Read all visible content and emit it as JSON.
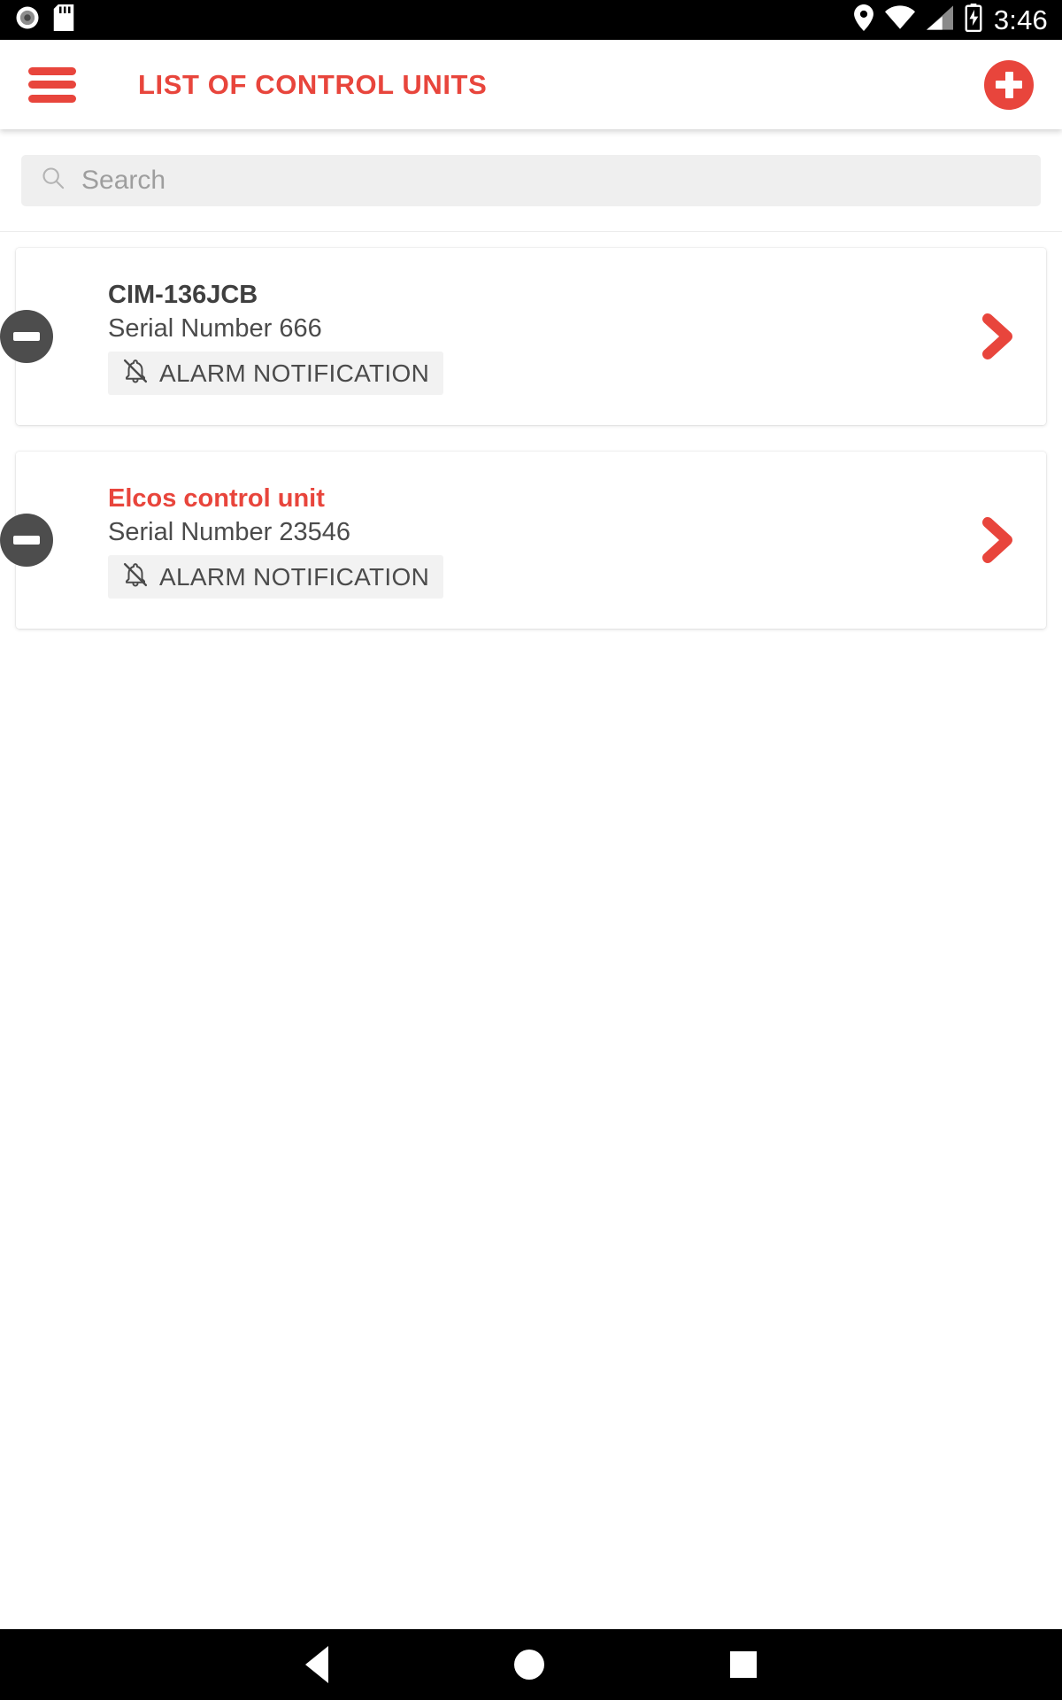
{
  "status_bar": {
    "icons_left": [
      "screen-record-icon",
      "sd-card-icon"
    ],
    "icons_right": [
      "location-pin-icon",
      "wifi-icon",
      "cellular-signal-icon",
      "battery-charging-icon"
    ],
    "time": "3:46"
  },
  "app_bar": {
    "menu_icon": "hamburger-menu-icon",
    "title": "LIST OF CONTROL UNITS",
    "add_icon": "plus-icon",
    "accent_color": "#e8453c"
  },
  "search": {
    "icon": "search-icon",
    "placeholder": "Search",
    "value": ""
  },
  "units": [
    {
      "name": "CIM-136JCB",
      "name_color": "#3f3f3f",
      "serial": "Serial Number 666",
      "status_icon": "minus-circle-icon",
      "alarm_icon": "bell-off-icon",
      "alarm_label": "ALARM NOTIFICATION",
      "chevron_icon": "chevron-right-icon"
    },
    {
      "name": "Elcos control unit",
      "name_color": "#e8453c",
      "serial": "Serial Number 23546",
      "status_icon": "minus-circle-icon",
      "alarm_icon": "bell-off-icon",
      "alarm_label": "ALARM NOTIFICATION",
      "chevron_icon": "chevron-right-icon"
    }
  ],
  "nav_bar": {
    "back": "back-triangle-icon",
    "home": "home-circle-icon",
    "recents": "recents-square-icon"
  }
}
